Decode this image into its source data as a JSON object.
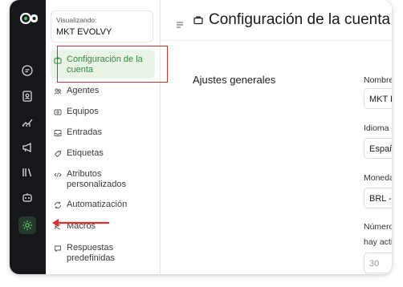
{
  "account": {
    "label": "Visualizando:",
    "name": "MKT EVOLVY"
  },
  "nav": [
    {
      "name": "nav-configuracion-cuenta",
      "icon": "briefcase-icon",
      "label": "Configuración de la cuenta",
      "active": true
    },
    {
      "name": "nav-agentes",
      "icon": "users-icon",
      "label": "Agentes"
    },
    {
      "name": "nav-equipos",
      "icon": "team-icon",
      "label": "Equipos"
    },
    {
      "name": "nav-entradas",
      "icon": "inbox-icon",
      "label": "Entradas"
    },
    {
      "name": "nav-etiquetas",
      "icon": "tag-icon",
      "label": "Etiquetas"
    },
    {
      "name": "nav-atributos",
      "icon": "code-icon",
      "label": "Atributos personalizados"
    },
    {
      "name": "nav-automatizacion",
      "icon": "automation-icon",
      "label": "Automatización"
    },
    {
      "name": "nav-macros",
      "icon": "macro-icon",
      "label": "Macros"
    },
    {
      "name": "nav-respuestas",
      "icon": "chat-icon",
      "label": "Respuestas predefinidas"
    }
  ],
  "rail_icons": [
    "chat-icon",
    "contacts-icon",
    "reports-icon",
    "campaigns-icon",
    "library-icon",
    "bot-icon",
    "settings-icon"
  ],
  "header": {
    "title": "Configuración de la cuenta"
  },
  "section_title": "Ajustes generales",
  "fields": {
    "account_name": {
      "label": "Nombre d",
      "value": "MKT EVOLV"
    },
    "language": {
      "label": "Idioma de",
      "value": "Españo"
    },
    "currency": {
      "label": "Moneda",
      "value": "BRL - R"
    },
    "number": {
      "label_line1": "Número d",
      "label_line2": "hay activi",
      "placeholder": "30"
    }
  },
  "colors": {
    "accent": "#2e8b3a",
    "rail_bg": "#15171b",
    "highlight": "#d9302b"
  }
}
